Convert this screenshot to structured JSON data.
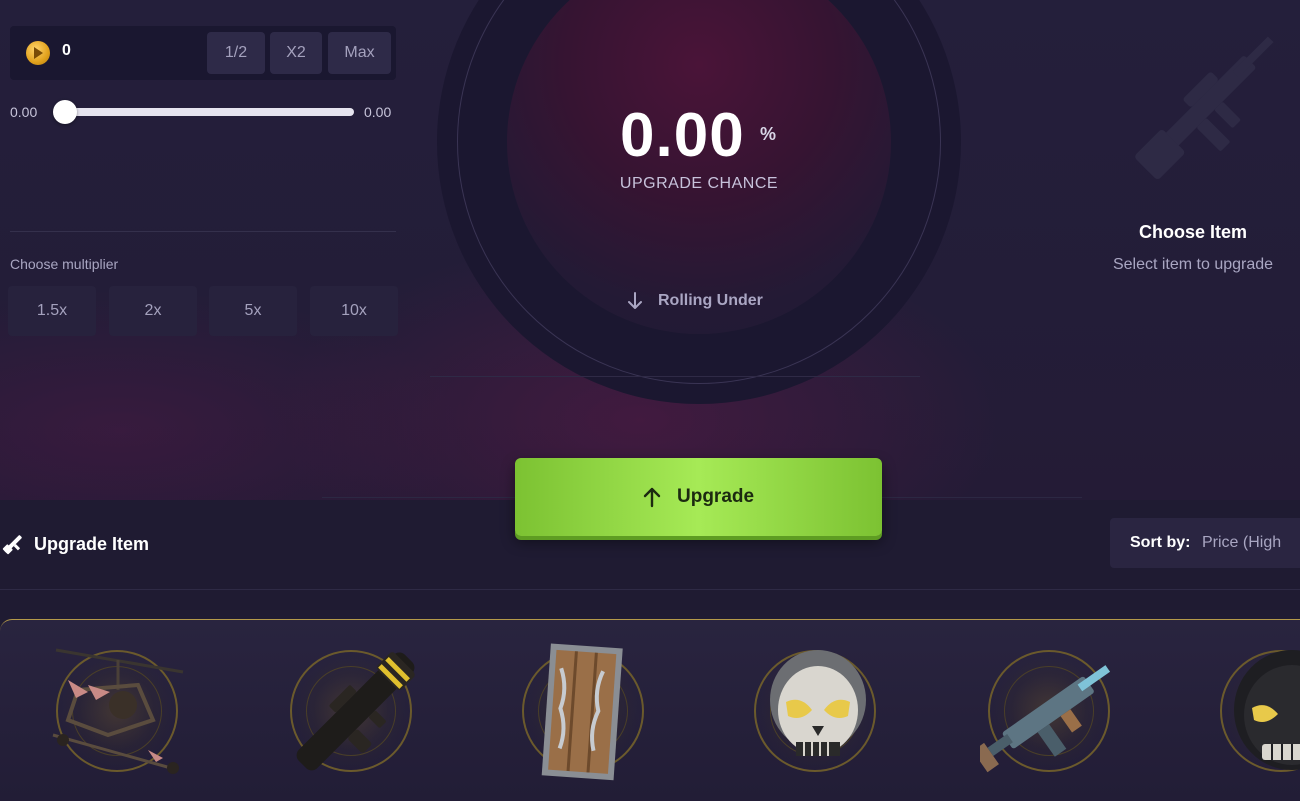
{
  "bet": {
    "amount": "0",
    "buttons": [
      "1/2",
      "X2",
      "Max"
    ],
    "slider_min": "0.00",
    "slider_max": "0.00"
  },
  "multiplier": {
    "label": "Choose multiplier",
    "options": [
      "1.5x",
      "2x",
      "5x",
      "10x"
    ]
  },
  "dial": {
    "chance_value": "0.00",
    "chance_unit": "%",
    "chance_label": "UPGRADE CHANCE",
    "rolling_label": "Rolling Under"
  },
  "upgrade_button": {
    "label": "Upgrade"
  },
  "target": {
    "title": "Choose Item",
    "subtitle": "Select item to upgrade"
  },
  "items_section": {
    "title": "Upgrade Item",
    "sort_label": "Sort by:",
    "sort_value": "Price (High"
  },
  "items": [
    {
      "icon": "minicopter-icon"
    },
    {
      "icon": "rocket-launcher-icon"
    },
    {
      "icon": "wooden-door-icon"
    },
    {
      "icon": "metal-skull-helmet-icon"
    },
    {
      "icon": "smg-icon"
    },
    {
      "icon": "dark-skull-mask-icon"
    }
  ],
  "colors": {
    "background": "#1f1b32",
    "accent_green": "#8fd640",
    "rarity_gold": "#b49a4a"
  }
}
